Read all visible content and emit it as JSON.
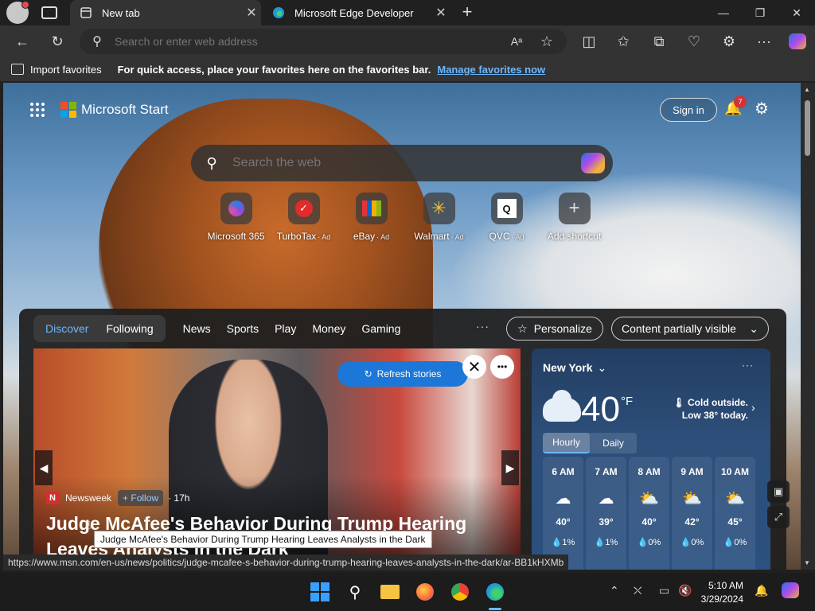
{
  "browser": {
    "tabs": [
      {
        "title": "New tab",
        "active": true
      },
      {
        "title": "Microsoft Edge Developer",
        "active": false
      }
    ],
    "address_placeholder": "Search or enter web address",
    "favorites_bar": {
      "import_label": "Import favorites",
      "message": "For quick access, place your favorites here on the favorites bar.",
      "manage_link": "Manage favorites now"
    },
    "status_url": "https://www.msn.com/en-us/news/politics/judge-mcafee-s-behavior-during-trump-hearing-leaves-analysts-in-the-dark/ar-BB1kHXMb"
  },
  "start": {
    "brand": "Microsoft Start",
    "sign_in": "Sign in",
    "notification_count": "7",
    "search_placeholder": "Search the web",
    "shortcuts": [
      {
        "label": "Microsoft 365",
        "ad": ""
      },
      {
        "label": "TurboTax",
        "ad": "· Ad"
      },
      {
        "label": "eBay",
        "ad": "· Ad"
      },
      {
        "label": "Walmart",
        "ad": "· Ad"
      },
      {
        "label": "QVC",
        "ad": "· Ad"
      },
      {
        "label": "Add shortcut",
        "ad": ""
      }
    ]
  },
  "feed": {
    "segment": [
      "Discover",
      "Following"
    ],
    "nav": [
      "News",
      "Sports",
      "Play",
      "Money",
      "Gaming"
    ],
    "more": "···",
    "personalize": "Personalize",
    "content_visibility": "Content partially visible",
    "refresh": "Refresh stories",
    "story": {
      "source": "Newsweek",
      "follow": "+ Follow",
      "age": "· 17h",
      "headline": "Judge McAfee's Behavior During Trump Hearing Leaves Analysts in the Dark",
      "tooltip": "Judge McAfee's Behavior During Trump Hearing Leaves Analysts in the Dark"
    }
  },
  "weather": {
    "location": "New York",
    "temp": "40",
    "unit": "°F",
    "note": "Cold outside. Low 38° today.",
    "tabs": [
      "Hourly",
      "Daily"
    ],
    "hours": [
      {
        "time": "6 AM",
        "temp": "40°",
        "precip": "1%",
        "icon": "☁"
      },
      {
        "time": "7 AM",
        "temp": "39°",
        "precip": "1%",
        "icon": "☁"
      },
      {
        "time": "8 AM",
        "temp": "40°",
        "precip": "0%",
        "icon": "⛅"
      },
      {
        "time": "9 AM",
        "temp": "42°",
        "precip": "0%",
        "icon": "⛅"
      },
      {
        "time": "10 AM",
        "temp": "45°",
        "precip": "0%",
        "icon": "⛅"
      }
    ]
  },
  "taskbar": {
    "time": "5:10 AM",
    "date": "3/29/2024"
  }
}
